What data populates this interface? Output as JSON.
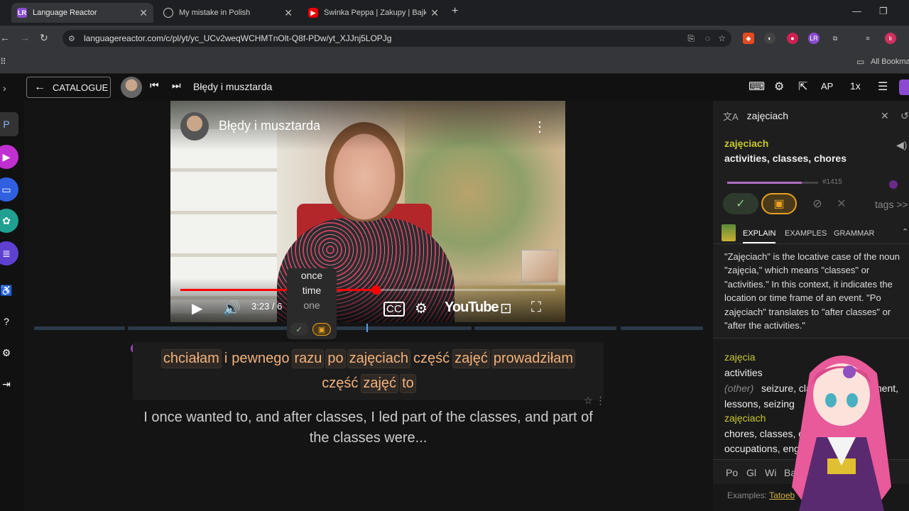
{
  "browser": {
    "tabs": [
      {
        "title": "Language Reactor",
        "active": true
      },
      {
        "title": "My mistake in Polish",
        "active": false
      },
      {
        "title": "Świnka Peppa | Zakupy | Bajki P",
        "active": false
      }
    ],
    "new_tab_label": "+",
    "url": "languagereactor.com/c/pl/yt/yc_UCv2weqWCHMTnOlt-Q8f-PDw/yt_XJJnj5LOPJg",
    "bookmarks_label": "All Bookmar",
    "profile_initial": "k"
  },
  "app": {
    "catalogue_label": "CATALOGUE",
    "video_title": "Błędy i musztarda",
    "toolbar": {
      "ap_label": "AP",
      "speed_label": "1x"
    }
  },
  "player": {
    "title": "Błędy i musztarda",
    "time": "3:23 / 6",
    "youtube_label": "YouTube",
    "progress_fraction": 0.52
  },
  "popup": {
    "words": [
      "once",
      "time",
      "one"
    ]
  },
  "subtitle": {
    "line1": [
      {
        "t": "chciałam",
        "hl": true
      },
      {
        "t": "i",
        "hl": false
      },
      {
        "t": "pewnego",
        "hl": false
      },
      {
        "t": "razu",
        "hl": true
      },
      {
        "t": "po",
        "hl": true
      },
      {
        "t": "zajęciach",
        "hl": true
      },
      {
        "t": "część",
        "hl": false
      },
      {
        "t": "zajęć",
        "hl": true
      },
      {
        "t": "prowadziłam",
        "hl": true
      }
    ],
    "line2": [
      {
        "t": "część",
        "hl": false
      },
      {
        "t": "zajęć",
        "hl": true
      },
      {
        "t": "to",
        "hl": true
      }
    ],
    "translation": "I once wanted to, and after classes, I led part of the classes, and part of the classes were..."
  },
  "dictionary": {
    "search_term": "zajęciach",
    "lemma": "zajęciach",
    "gloss": "activities, classes, chores",
    "frequency_rank": "#1415",
    "frequency_fraction": 0.82,
    "tags_label": "tags >>",
    "tabs": [
      "EXPLAIN",
      "EXAMPLES",
      "GRAMMAR"
    ],
    "explain_text": "\"Zajęciach\" is the locative case of the noun \"zajęcia,\" which means \"classes\" or \"activities.\" In this context, it indicates the location or time frame of an event. \"Po zajęciach\" translates to \"after classes\" or \"after the activities.\"",
    "defs": {
      "head1": "zajęcia",
      "def1": "activities",
      "other_label": "(other)",
      "other_text": "seizure, cla",
      "other_tail": "ment,",
      "def1b": "lessons, seizing",
      "head2": "zajęciach",
      "def2": "chores, classes, co",
      "def2b": "occupations, engag"
    },
    "dict_sources": [
      "Po",
      "Gl",
      "Wi",
      "Ba"
    ],
    "examples_label": "Examples:",
    "examples_link": "Tatoeb"
  },
  "colors": {
    "highlight_word": "#f3b27a",
    "lemma": "#c8c830",
    "accent_purple": "#a040c0",
    "known_green": "#3a7a3a",
    "learning_orange": "#e8a020"
  }
}
